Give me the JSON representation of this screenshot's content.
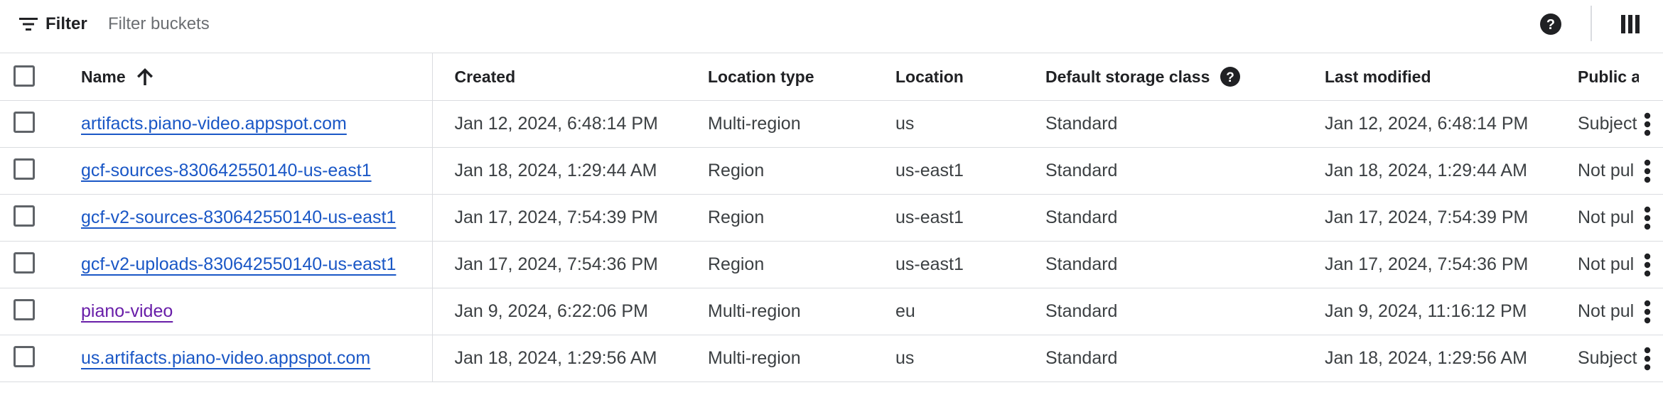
{
  "toolbar": {
    "filter_label": "Filter",
    "filter_placeholder": "Filter buckets"
  },
  "icons": {
    "filter": "filter-lines-icon",
    "help": "help-circle-icon",
    "columns": "column-display-icon",
    "sort": "arrow-up-icon",
    "row_menu": "more-vert-icon"
  },
  "colors": {
    "link": "#1a57c6",
    "link_visited": "#681da8",
    "border": "#dadce0"
  },
  "table": {
    "headers": {
      "name": "Name",
      "created": "Created",
      "location_type": "Location type",
      "location": "Location",
      "storage_class": "Default storage class",
      "last_modified": "Last modified",
      "public_access": "Public a"
    },
    "rows": [
      {
        "name": "artifacts.piano-video.appspot.com",
        "created": "Jan 12, 2024, 6:48:14 PM",
        "location_type": "Multi-region",
        "location": "us",
        "storage_class": "Standard",
        "last_modified": "Jan 12, 2024, 6:48:14 PM",
        "public_access": "Subject"
      },
      {
        "name": "gcf-sources-830642550140-us-east1",
        "created": "Jan 18, 2024, 1:29:44 AM",
        "location_type": "Region",
        "location": "us-east1",
        "storage_class": "Standard",
        "last_modified": "Jan 18, 2024, 1:29:44 AM",
        "public_access": "Not pul"
      },
      {
        "name": "gcf-v2-sources-830642550140-us-east1",
        "created": "Jan 17, 2024, 7:54:39 PM",
        "location_type": "Region",
        "location": "us-east1",
        "storage_class": "Standard",
        "last_modified": "Jan 17, 2024, 7:54:39 PM",
        "public_access": "Not pul"
      },
      {
        "name": "gcf-v2-uploads-830642550140-us-east1",
        "created": "Jan 17, 2024, 7:54:36 PM",
        "location_type": "Region",
        "location": "us-east1",
        "storage_class": "Standard",
        "last_modified": "Jan 17, 2024, 7:54:36 PM",
        "public_access": "Not pul"
      },
      {
        "name": "piano-video",
        "created": "Jan 9, 2024, 6:22:06 PM",
        "location_type": "Multi-region",
        "location": "eu",
        "storage_class": "Standard",
        "last_modified": "Jan 9, 2024, 11:16:12 PM",
        "public_access": "Not pul"
      },
      {
        "name": "us.artifacts.piano-video.appspot.com",
        "created": "Jan 18, 2024, 1:29:56 AM",
        "location_type": "Multi-region",
        "location": "us",
        "storage_class": "Standard",
        "last_modified": "Jan 18, 2024, 1:29:56 AM",
        "public_access": "Subject"
      }
    ]
  }
}
